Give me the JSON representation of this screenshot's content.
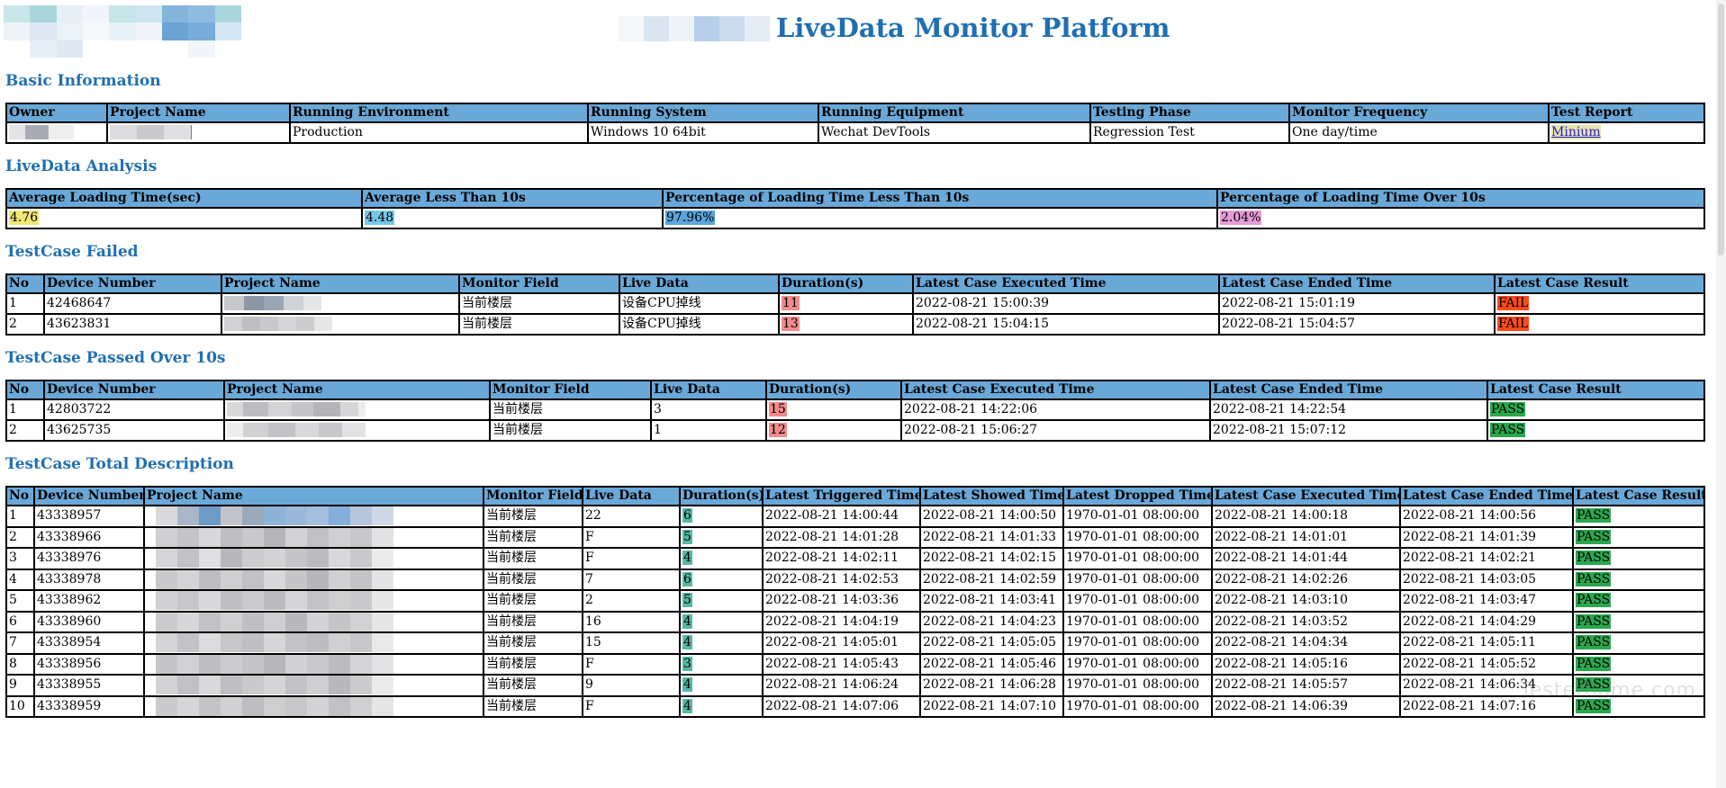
{
  "header": {
    "title": "LiveData Monitor Platform"
  },
  "basic_info": {
    "section_title": "Basic Information",
    "columns": [
      "Owner",
      "Project Name",
      "Running Environment",
      "Running System",
      "Running Equipment",
      "Testing Phase",
      "Monitor Frequency",
      "Test Report"
    ],
    "row": {
      "environment": "Production",
      "system": "Windows 10 64bit",
      "equipment": "Wechat DevTools",
      "phase": "Regression Test",
      "frequency": "One day/time",
      "report_link": "Minium"
    }
  },
  "analysis": {
    "section_title": "LiveData Analysis",
    "columns": [
      "Average Loading Time(sec)",
      "Average Less Than 10s",
      "Percentage of Loading Time Less Than 10s",
      "Percentage of Loading Time Over 10s"
    ],
    "values": [
      "4.76",
      "4.48",
      "97.96%",
      "2.04%"
    ]
  },
  "failed": {
    "section_title": "TestCase Failed",
    "columns": [
      "No",
      "Device Number",
      "Project Name",
      "Monitor Field",
      "Live Data",
      "Duration(s)",
      "Latest Case Executed Time",
      "Latest Case Ended Time",
      "Latest Case Result"
    ],
    "rows": [
      {
        "no": "1",
        "device": "42468647",
        "field": "当前楼层",
        "live": "设备CPU掉线",
        "duration": "11",
        "executed": "2022-08-21 15:00:39",
        "ended": "2022-08-21 15:01:19",
        "result": "FAIL"
      },
      {
        "no": "2",
        "device": "43623831",
        "field": "当前楼层",
        "live": "设备CPU掉线",
        "duration": "13",
        "executed": "2022-08-21 15:04:15",
        "ended": "2022-08-21 15:04:57",
        "result": "FAIL"
      }
    ]
  },
  "passed_over": {
    "section_title": "TestCase Passed Over 10s",
    "columns": [
      "No",
      "Device Number",
      "Project Name",
      "Monitor Field",
      "Live Data",
      "Duration(s)",
      "Latest Case Executed Time",
      "Latest Case Ended Time",
      "Latest Case Result"
    ],
    "rows": [
      {
        "no": "1",
        "device": "42803722",
        "field": "当前楼层",
        "live": "3",
        "duration": "15",
        "executed": "2022-08-21 14:22:06",
        "ended": "2022-08-21 14:22:54",
        "result": "PASS"
      },
      {
        "no": "2",
        "device": "43625735",
        "field": "当前楼层",
        "live": "1",
        "duration": "12",
        "executed": "2022-08-21 15:06:27",
        "ended": "2022-08-21 15:07:12",
        "result": "PASS"
      }
    ]
  },
  "total": {
    "section_title": "TestCase Total Description",
    "columns": [
      "No",
      "Device Number",
      "Project Name",
      "Monitor Field",
      "Live Data",
      "Duration(s)",
      "Latest Triggered Time",
      "Latest Showed Time",
      "Latest Dropped Time",
      "Latest Case Executed Time",
      "Latest Case Ended Time",
      "Latest Case Result"
    ],
    "rows": [
      {
        "no": "1",
        "device": "43338957",
        "field": "当前楼层",
        "live": "22",
        "duration": "6",
        "triggered": "2022-08-21 14:00:44",
        "showed": "2022-08-21 14:00:50",
        "dropped": "1970-01-01 08:00:00",
        "executed": "2022-08-21 14:00:18",
        "ended": "2022-08-21 14:00:56",
        "result": "PASS"
      },
      {
        "no": "2",
        "device": "43338966",
        "field": "当前楼层",
        "live": "F",
        "duration": "5",
        "triggered": "2022-08-21 14:01:28",
        "showed": "2022-08-21 14:01:33",
        "dropped": "1970-01-01 08:00:00",
        "executed": "2022-08-21 14:01:01",
        "ended": "2022-08-21 14:01:39",
        "result": "PASS"
      },
      {
        "no": "3",
        "device": "43338976",
        "field": "当前楼层",
        "live": "F",
        "duration": "4",
        "triggered": "2022-08-21 14:02:11",
        "showed": "2022-08-21 14:02:15",
        "dropped": "1970-01-01 08:00:00",
        "executed": "2022-08-21 14:01:44",
        "ended": "2022-08-21 14:02:21",
        "result": "PASS"
      },
      {
        "no": "4",
        "device": "43338978",
        "field": "当前楼层",
        "live": "7",
        "duration": "6",
        "triggered": "2022-08-21 14:02:53",
        "showed": "2022-08-21 14:02:59",
        "dropped": "1970-01-01 08:00:00",
        "executed": "2022-08-21 14:02:26",
        "ended": "2022-08-21 14:03:05",
        "result": "PASS"
      },
      {
        "no": "5",
        "device": "43338962",
        "field": "当前楼层",
        "live": "2",
        "duration": "5",
        "triggered": "2022-08-21 14:03:36",
        "showed": "2022-08-21 14:03:41",
        "dropped": "1970-01-01 08:00:00",
        "executed": "2022-08-21 14:03:10",
        "ended": "2022-08-21 14:03:47",
        "result": "PASS"
      },
      {
        "no": "6",
        "device": "43338960",
        "field": "当前楼层",
        "live": "16",
        "duration": "4",
        "triggered": "2022-08-21 14:04:19",
        "showed": "2022-08-21 14:04:23",
        "dropped": "1970-01-01 08:00:00",
        "executed": "2022-08-21 14:03:52",
        "ended": "2022-08-21 14:04:29",
        "result": "PASS"
      },
      {
        "no": "7",
        "device": "43338954",
        "field": "当前楼层",
        "live": "15",
        "duration": "4",
        "triggered": "2022-08-21 14:05:01",
        "showed": "2022-08-21 14:05:05",
        "dropped": "1970-01-01 08:00:00",
        "executed": "2022-08-21 14:04:34",
        "ended": "2022-08-21 14:05:11",
        "result": "PASS"
      },
      {
        "no": "8",
        "device": "43338956",
        "field": "当前楼层",
        "live": "F",
        "duration": "3",
        "triggered": "2022-08-21 14:05:43",
        "showed": "2022-08-21 14:05:46",
        "dropped": "1970-01-01 08:00:00",
        "executed": "2022-08-21 14:05:16",
        "ended": "2022-08-21 14:05:52",
        "result": "PASS"
      },
      {
        "no": "9",
        "device": "43338955",
        "field": "当前楼层",
        "live": "9",
        "duration": "4",
        "triggered": "2022-08-21 14:06:24",
        "showed": "2022-08-21 14:06:28",
        "dropped": "1970-01-01 08:00:00",
        "executed": "2022-08-21 14:05:57",
        "ended": "2022-08-21 14:06:34",
        "result": "PASS"
      },
      {
        "no": "10",
        "device": "43338959",
        "field": "当前楼层",
        "live": "F",
        "duration": "4",
        "triggered": "2022-08-21 14:07:06",
        "showed": "2022-08-21 14:07:10",
        "dropped": "1970-01-01 08:00:00",
        "executed": "2022-08-21 14:06:39",
        "ended": "2022-08-21 14:07:16",
        "result": "PASS"
      }
    ]
  },
  "watermark": "Testerhome.com",
  "colors": {
    "accent": "#1f6fb2",
    "header_bg": "#6aa8d8",
    "fail": "#ff4a1a",
    "pass": "#2aa84f",
    "duration_over": "#f28b8b",
    "duration_ok": "#57b8a8"
  }
}
